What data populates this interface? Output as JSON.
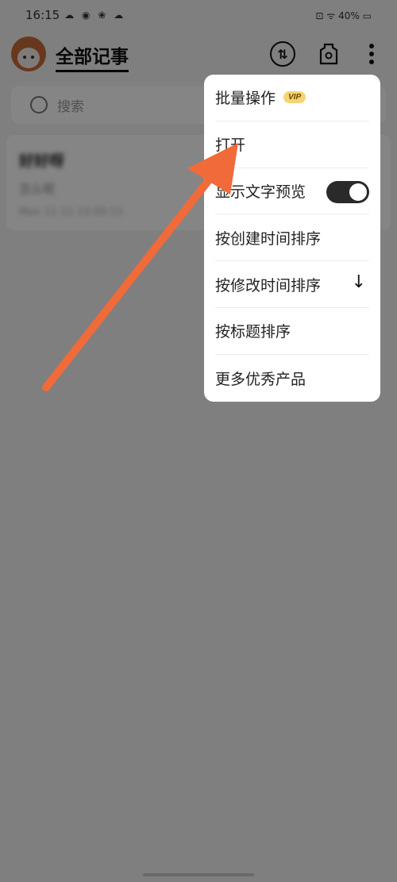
{
  "status_bar": {
    "time": "16:15",
    "icons": "☁ ◉ ❀ ☁",
    "right": "⊡ ᯤ 40% ▭"
  },
  "header": {
    "title": "全部记事"
  },
  "search": {
    "placeholder": "搜索"
  },
  "note": {
    "title": "好好呀",
    "subtitle": "怎么呢",
    "time": "Mon 11 11 15:00:15"
  },
  "menu": {
    "items": [
      {
        "label": "批量操作",
        "badge": "VIP"
      },
      {
        "label": "打开"
      },
      {
        "label": "显示文字预览",
        "toggle_on": true
      },
      {
        "label": "按创建时间排序"
      },
      {
        "label": "按修改时间排序",
        "arrow": "↓"
      },
      {
        "label": "按标题排序"
      },
      {
        "label": "更多优秀产品"
      }
    ]
  },
  "icons": {
    "sync": "sync-icon",
    "skin": "skin-icon",
    "more": "more-icon"
  },
  "colors": {
    "arrow": "#f06a3a",
    "toggle": "#2a2a2a",
    "vip_badge": "#f4d474"
  }
}
